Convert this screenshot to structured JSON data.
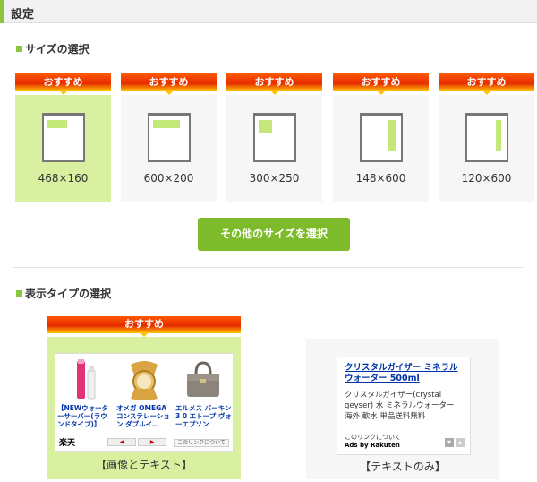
{
  "header": {
    "title": "設定"
  },
  "size_section": {
    "title": "サイズの選択",
    "recommend_label": "おすすめ",
    "sizes": [
      {
        "label": "468×160",
        "selected": true
      },
      {
        "label": "600×200",
        "selected": false
      },
      {
        "label": "300×250",
        "selected": false
      },
      {
        "label": "148×600",
        "selected": false
      },
      {
        "label": "120×600",
        "selected": false
      }
    ],
    "other_button": "その他のサイズを選択"
  },
  "type_section": {
    "title": "表示タイプの選択",
    "recommend_label": "おすすめ",
    "image_text": {
      "label": "【画像とテキスト】",
      "selected": true,
      "products": [
        {
          "text": "【NEWウォーターサーバー(ラウンドタイプ)】",
          "icon": "water-server"
        },
        {
          "text": "オメガ OMEGA コンステレーション ダブルイ…",
          "icon": "gold-watch"
        },
        {
          "text": "エルメス バーキン 3 0 エトープ ヴォーエプソン",
          "icon": "handbag"
        }
      ],
      "brand": "楽天",
      "prev_glyph": "◀",
      "next_glyph": "▶",
      "link_text": "このリンクについて"
    },
    "text_only": {
      "label": "【テキストのみ】",
      "ad_title": "クリスタルガイザー ミネラルウォーター 500ml",
      "ad_desc": "クリスタルガイザー(crystal geyser) 水 ミネラルウォーター 海外 軟水 単品送料無料",
      "foot_link": "このリンクについて",
      "foot_ads": "Ads by Rakuten",
      "icons": [
        "chevron-down-icon",
        "chevron-up-icon"
      ]
    }
  },
  "colors": {
    "accent": "#8cc63f",
    "button": "#7dbb2a",
    "selected_bg": "#d8f0a0",
    "ribbon_top": "#ff5a00",
    "ribbon_bottom": "#ffc600"
  }
}
